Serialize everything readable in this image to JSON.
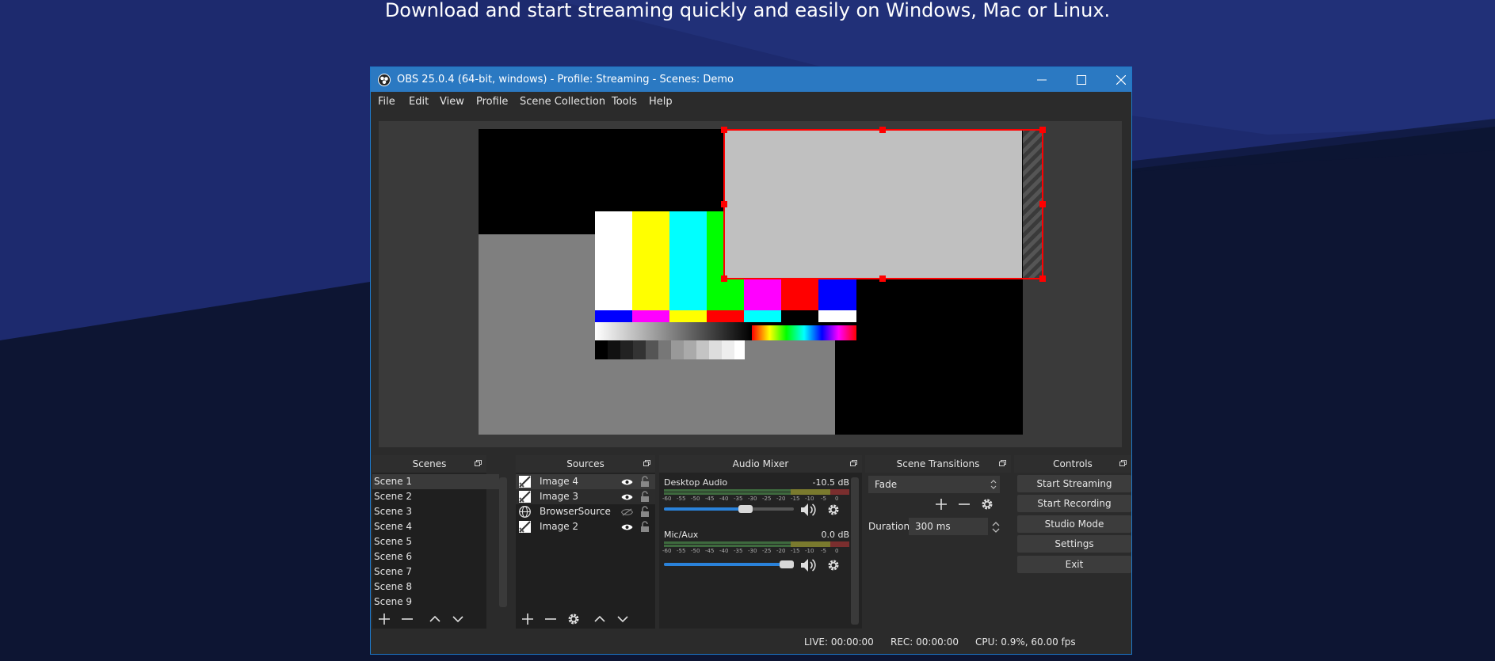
{
  "page": {
    "tagline": "Download and start streaming quickly and easily on Windows, Mac or Linux."
  },
  "window": {
    "title": "OBS 25.0.4 (64-bit, windows) - Profile: Streaming - Scenes: Demo",
    "icon": "obs-logo-icon",
    "controls": [
      "minimize-icon",
      "maximize-icon",
      "close-icon"
    ]
  },
  "menu": [
    "File",
    "Edit",
    "View",
    "Profile",
    "Scene Collection",
    "Tools",
    "Help"
  ],
  "colors": {
    "titlebar": "#2b79c2",
    "selection": "#ff0000",
    "accent": "#2a82da"
  },
  "scenes": {
    "title": "Scenes",
    "items": [
      "Scene 1",
      "Scene 2",
      "Scene 3",
      "Scene 4",
      "Scene 5",
      "Scene 6",
      "Scene 7",
      "Scene 8",
      "Scene 9"
    ],
    "selected": "Scene 1",
    "toolbar": [
      "add-icon",
      "remove-icon",
      "move-up-icon",
      "move-down-icon"
    ]
  },
  "sources": {
    "title": "Sources",
    "items": [
      {
        "name": "Image 4",
        "icon": "image-icon",
        "visible": true,
        "locked": false
      },
      {
        "name": "Image 3",
        "icon": "image-icon",
        "visible": true,
        "locked": false
      },
      {
        "name": "BrowserSource",
        "icon": "globe-icon",
        "visible": false,
        "locked": false
      },
      {
        "name": "Image 2",
        "icon": "image-icon",
        "visible": true,
        "locked": false
      }
    ],
    "toolbar": [
      "add-icon",
      "remove-icon",
      "settings-icon",
      "move-up-icon",
      "move-down-icon"
    ]
  },
  "audio_mixer": {
    "title": "Audio Mixer",
    "scale_labels": [
      "-60",
      "-55",
      "-50",
      "-45",
      "-40",
      "-35",
      "-30",
      "-25",
      "-20",
      "-15",
      "-10",
      "-5",
      "0"
    ],
    "channels": [
      {
        "name": "Desktop Audio",
        "db": "-10.5 dB",
        "volume": 0.63
      },
      {
        "name": "Mic/Aux",
        "db": "0.0 dB",
        "volume": 1.0
      }
    ]
  },
  "scene_transitions": {
    "title": "Scene Transitions",
    "transition": "Fade",
    "duration_label": "Duration",
    "duration_value": "300 ms"
  },
  "controls": {
    "title": "Controls",
    "buttons": [
      "Start Streaming",
      "Start Recording",
      "Studio Mode",
      "Settings",
      "Exit"
    ]
  },
  "status": {
    "live": "LIVE: 00:00:00",
    "rec": "REC: 00:00:00",
    "cpu": "CPU: 0.9%, 60.00 fps"
  }
}
